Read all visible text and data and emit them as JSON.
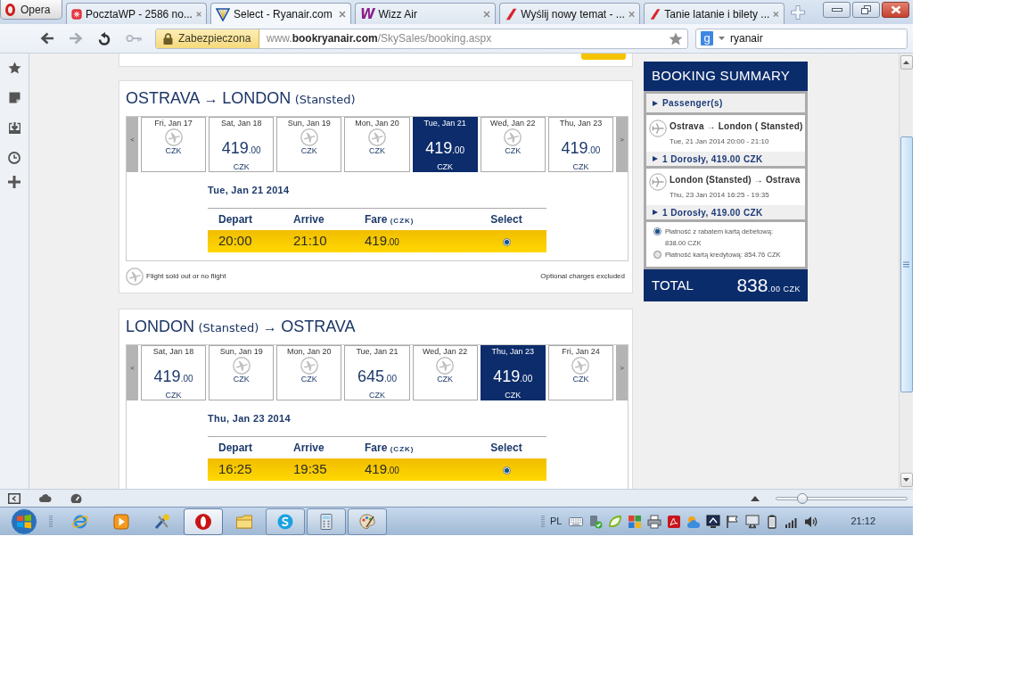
{
  "browser": {
    "menu_button": "Opera",
    "tabs": [
      {
        "label": "PocztaWP - 2586 no...",
        "selected": false
      },
      {
        "label": "Select - Ryanair.com",
        "selected": true
      },
      {
        "label": "Wizz Air",
        "selected": false,
        "logo_text": "W"
      },
      {
        "label": "Wyślij nowy temat - ...",
        "selected": false
      },
      {
        "label": "Tanie latanie i bilety ...",
        "selected": false
      }
    ],
    "address_bar": {
      "security_label": "Zabezpieczona",
      "url": "www.**bookryanair.com**/SkySales/booking.aspx"
    },
    "search_field": {
      "engine_badge": "g",
      "value": "ryanair"
    }
  },
  "flights": [
    {
      "route": [
        {
          "kind": "city",
          "text": "OSTRAVA"
        },
        {
          "kind": "arrow",
          "text": "→"
        },
        {
          "kind": "city",
          "text": "LONDON"
        },
        {
          "kind": "airport",
          "text": "(Stansted)"
        }
      ],
      "prev_label": "<",
      "next_label": ">",
      "dates": [
        {
          "day": "Fri, Jan 17",
          "available": false,
          "currency": "CZK",
          "selected": false
        },
        {
          "day": "Sat, Jan 18",
          "available": true,
          "price": "419",
          "decimals": ".00",
          "currency": "CZK",
          "selected": false
        },
        {
          "day": "Sun, Jan 19",
          "available": false,
          "currency": "CZK",
          "selected": false
        },
        {
          "day": "Mon, Jan 20",
          "available": false,
          "currency": "CZK",
          "selected": false
        },
        {
          "day": "Tue, Jan 21",
          "available": true,
          "price": "419",
          "decimals": ".00",
          "currency": "CZK",
          "selected": true
        },
        {
          "day": "Wed, Jan 22",
          "available": false,
          "currency": "CZK",
          "selected": false
        },
        {
          "day": "Thu, Jan 23",
          "available": true,
          "price": "419",
          "decimals": ".00",
          "currency": "CZK",
          "selected": false
        }
      ],
      "selected_date": "Tue, Jan 21 2014",
      "columns": [
        {
          "label": "Depart"
        },
        {
          "label": "Arrive"
        },
        {
          "label": "Fare",
          "unit": "(CZK)"
        },
        {
          "label": "Select"
        }
      ],
      "rows": [
        {
          "depart": "20:00",
          "arrive": "21:10",
          "fare": "419",
          "decimals": ".00",
          "selected": true
        }
      ],
      "legend": "Flight sold out or no flight",
      "note": "Optional charges excluded"
    },
    {
      "route": [
        {
          "kind": "city",
          "text": "LONDON"
        },
        {
          "kind": "airport",
          "text": "(Stansted)"
        },
        {
          "kind": "arrow",
          "text": "→"
        },
        {
          "kind": "city",
          "text": "OSTRAVA"
        }
      ],
      "prev_label": "<",
      "next_label": ">",
      "dates": [
        {
          "day": "Sat, Jan 18",
          "available": true,
          "price": "419",
          "decimals": ".00",
          "currency": "CZK",
          "selected": false
        },
        {
          "day": "Sun, Jan 19",
          "available": false,
          "currency": "CZK",
          "selected": false
        },
        {
          "day": "Mon, Jan 20",
          "available": false,
          "currency": "CZK",
          "selected": false
        },
        {
          "day": "Tue, Jan 21",
          "available": true,
          "price": "645",
          "decimals": ".00",
          "currency": "CZK",
          "selected": false
        },
        {
          "day": "Wed, Jan 22",
          "available": false,
          "currency": "CZK",
          "selected": false
        },
        {
          "day": "Thu, Jan 23",
          "available": true,
          "price": "419",
          "decimals": ".00",
          "currency": "CZK",
          "selected": true
        },
        {
          "day": "Fri, Jan 24",
          "available": false,
          "currency": "CZK",
          "selected": false
        }
      ],
      "selected_date": "Thu, Jan 23 2014",
      "columns": [
        {
          "label": "Depart"
        },
        {
          "label": "Arrive"
        },
        {
          "label": "Fare",
          "unit": "(CZK)"
        },
        {
          "label": "Select"
        }
      ],
      "rows": [
        {
          "depart": "16:25",
          "arrive": "19:35",
          "fare": "419",
          "decimals": ".00",
          "selected": true
        }
      ]
    }
  ],
  "summary": {
    "title": "BOOKING SUMMARY",
    "passengers_label": "Passenger(s)",
    "legs": [
      {
        "route": "Ostrava → London ( Stansted)",
        "times": "Tue, 21 Jan 2014 20:00 - 21:10",
        "fare_line": "1 Dorosły, 419.00 CZK"
      },
      {
        "route": "London (Stansted) → Ostrava",
        "times": "Thu, 23 Jan 2014 16:25 - 19:35",
        "fare_line": "1 Dorosły, 419.00 CZK"
      }
    ],
    "payment_options": [
      {
        "label": "Płatność z rabatem kartą debetową: 838.00 CZK",
        "selected": true
      },
      {
        "label": "Płatność kartą kredytową: 854.76 CZK",
        "selected": false
      }
    ],
    "total_label": "TOTAL",
    "total_amount": "838",
    "total_decimals": ".00",
    "total_currency": "CZK"
  },
  "status_bar": {
    "zoom_slider": {
      "level": 0.2
    }
  },
  "taskbar": {
    "apps": [
      {
        "running": false,
        "selected": false
      },
      {
        "running": false,
        "selected": false
      },
      {
        "running": false,
        "selected": false
      },
      {
        "running": true,
        "selected": true
      },
      {
        "running": false,
        "selected": false
      },
      {
        "running": true,
        "selected": false
      },
      {
        "running": true,
        "selected": false
      },
      {
        "running": true,
        "selected": false
      }
    ],
    "language": "PL",
    "clock": "21:12"
  }
}
